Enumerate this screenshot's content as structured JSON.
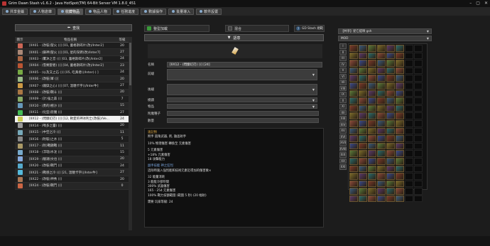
{
  "window": {
    "title": "Grim Dawn Stash v1.6.2 - Java HotSpot(TM) 64-Bit Server VM 1.8.0_451",
    "min": "–",
    "max": "▢",
    "close": "✕"
  },
  "tabs": [
    {
      "label": "共享金鑰",
      "icon": "key-icon"
    },
    {
      "label": "人物倉庫",
      "icon": "character-icon"
    },
    {
      "label": "收藏物品",
      "icon": "collection-icon"
    },
    {
      "label": "物品人物",
      "icon": "item-character-icon"
    },
    {
      "label": "任務進度",
      "icon": "quest-icon"
    },
    {
      "label": "數據操作",
      "icon": "data-icon"
    },
    {
      "label": "批量導入",
      "icon": "import-icon"
    },
    {
      "label": "軟件設置",
      "icon": "settings-icon"
    }
  ],
  "left": {
    "search_label": "查找",
    "col_icon": "圖示",
    "col_name": "物品名稱",
    "col_level": "等級",
    "rows": [
      {
        "name": "[IIX01 - (改裝)聖火 ()] [01, 蕾格斯碎片(改)/Inter2]",
        "level": "20",
        "color": "#c65"
      },
      {
        "name": "[IIX01 - (鎖神)聖火 ()] [01, 星的深鍔(改)/Inter7]",
        "level": "27",
        "color": "#a87"
      },
      {
        "name": "[IIX03 - (驚沐之音 ()] [03, 蕾格斯碎片(改)/Inter2]",
        "level": "24",
        "color": "#a64"
      },
      {
        "name": "[IIX04 - (雪類聖者) ()] [04, 蕾格斯碎片(改)/Inter2]",
        "level": "23",
        "color": "#b53"
      },
      {
        "name": "[IIX05 - (以及又之石 ()] [05, 吃黃者()/Inter(·) ]",
        "level": "24",
        "color": "#7a4"
      },
      {
        "name": "[IIX06 - (改裝)軍 ()]",
        "level": "20",
        "color": "#9b8"
      },
      {
        "name": "[IIX07 - (鐵獄之心) ()] [07, 溫糖卡字()/Inter牛]",
        "level": "27",
        "color": "#c94"
      },
      {
        "name": "[IIX08 - (改裝)戰斗 ()]",
        "level": "20",
        "color": "#a74"
      },
      {
        "name": "[IIX09 - (計)強之森 ()]",
        "level": "7",
        "color": "#8a6"
      },
      {
        "name": "[IIX10 - (勇的)極沙 ()]",
        "level": "15",
        "color": "#69b"
      },
      {
        "name": "[IIX11 - (化型)惡魔 ()]",
        "level": "27",
        "color": "#4b5"
      },
      {
        "name": "[IIX12 - (閃爍幻刃) ()] [12, 軟愛的神冰利士(改裝)/Ve...",
        "level": "24",
        "color": "#cc5",
        "selected": true
      },
      {
        "name": "[IIX14 - (嗎多之靈) ()]",
        "level": "20",
        "color": "#999"
      },
      {
        "name": "[IIX15 - (中空之冷 ()]",
        "level": "11",
        "color": "#7ab"
      },
      {
        "name": "[IIX16 - (附裝)之水 ()]",
        "level": "5",
        "color": "#888"
      },
      {
        "name": "[IIX17 - (附)戰顯戰 ()]",
        "level": "11",
        "color": "#a96"
      },
      {
        "name": "[IIX18 - (浮瑙)水沈 ()]",
        "level": "15",
        "color": "#7ac"
      },
      {
        "name": "[IIX19 - (驗潮)文也 ()]",
        "level": "20",
        "color": "#8ad"
      },
      {
        "name": "[IIX20 - (改裝)戰鬥 ()]",
        "level": "24",
        "color": "#5ac"
      },
      {
        "name": "[IIX21 - (戰感之冷 ()] [21, 溫糖卡字()/Inter牛]",
        "level": "27",
        "color": "#5bd"
      },
      {
        "name": "[IIX22 - (改裝)神秀 ()]",
        "level": "20",
        "color": "#a75"
      },
      {
        "name": "[IIX24 - (改裝)戰鬥 ()]",
        "level": "0",
        "color": "#c64"
      }
    ]
  },
  "mid": {
    "check1": "整型加載",
    "check2": "混合",
    "gd": "GD Stash 規範",
    "sub_button": "語意",
    "name_label": "名稱",
    "name_value": "[IIX12 - (閃爍幻刃) ()] [24]",
    "prefix_label": "前綴",
    "suffix_label": "後綴",
    "f1_label": "模鑄",
    "f2_label": "物品",
    "f3_label": "附魔種子",
    "f4_label": "數量",
    "desc": {
      "head": "速記物",
      "type": "附手 圓角武器, 劍, 鎗晶射手",
      "l1": "10% 物理傷害 轉換至 元素傷害",
      "l2": "5 元素傷害",
      "l3": "+18% 元素傷害",
      "l4": "18 攻擊能力",
      "blue": "副手技能 神之狂烈",
      "l5": "這除時施入強烈能和技術元素近得加的傷害乘×",
      "l6": "32 能量消耗",
      "l7": "3 能能冷卻時間",
      "l8": "300% 武器傷害",
      "l9": "165 - 254 元素傷害",
      "l10": "100% 戰力技額範圍 (範圍 5 秒) (20 幅射)",
      "req": "需要 玩家等級: 24"
    }
  },
  "right": {
    "stash_label": "【共享】從它提映 gsh",
    "mod_label": "MOD",
    "side": [
      "I",
      "II",
      "III",
      "IV",
      "V",
      "VI",
      "VII",
      "VIII",
      "IX",
      "X",
      "XI",
      "XII",
      "XIII",
      "XIV",
      "XV",
      "XVI",
      "XVII",
      "XVIII",
      "XIX",
      "XX",
      "XXI"
    ]
  }
}
